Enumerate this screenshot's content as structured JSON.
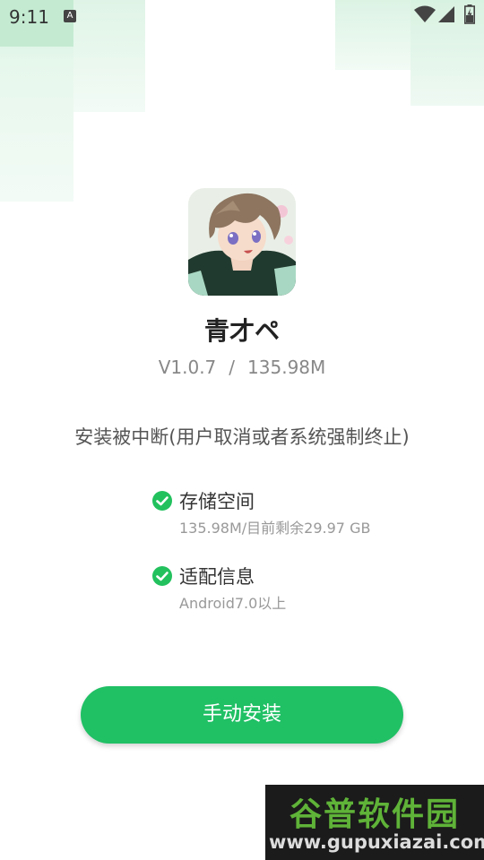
{
  "status_bar": {
    "time": "9:11",
    "notification_glyph": "A"
  },
  "app": {
    "name": "青才ペ",
    "version": "V1.0.7",
    "separator": "/",
    "size": "135.98M"
  },
  "message": "安装被中断(用户取消或者系统强制终止)",
  "checks": [
    {
      "title": "存储空间",
      "subtitle": "135.98M/目前剩余29.97 GB",
      "icon": "check-circle-icon"
    },
    {
      "title": "适配信息",
      "subtitle": "Android7.0以上",
      "icon": "check-circle-icon"
    }
  ],
  "install_button": {
    "label": "手动安装"
  },
  "watermark": {
    "title": "谷普软件园",
    "url": "www.gupuxiazai.com"
  },
  "colors": {
    "accent": "#20c065",
    "check": "#22c15e"
  }
}
